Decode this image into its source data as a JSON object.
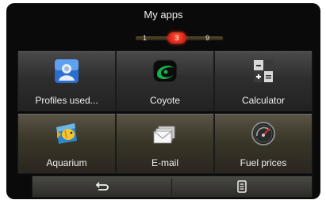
{
  "header": {
    "title": "My apps"
  },
  "pager": {
    "first": "1",
    "current": "3",
    "last": "9"
  },
  "apps": [
    {
      "label": "Profiles used...",
      "icon": "profile-icon"
    },
    {
      "label": "Coyote",
      "icon": "coyote-icon"
    },
    {
      "label": "Calculator",
      "icon": "calculator-icon"
    },
    {
      "label": "Aquarium",
      "icon": "aquarium-icon"
    },
    {
      "label": "E-mail",
      "icon": "email-icon"
    },
    {
      "label": "Fuel prices",
      "icon": "fuel-gauge-icon"
    }
  ],
  "bottom_bar": {
    "back_icon": "back-arrow-icon",
    "menu_icon": "menu-list-icon"
  }
}
